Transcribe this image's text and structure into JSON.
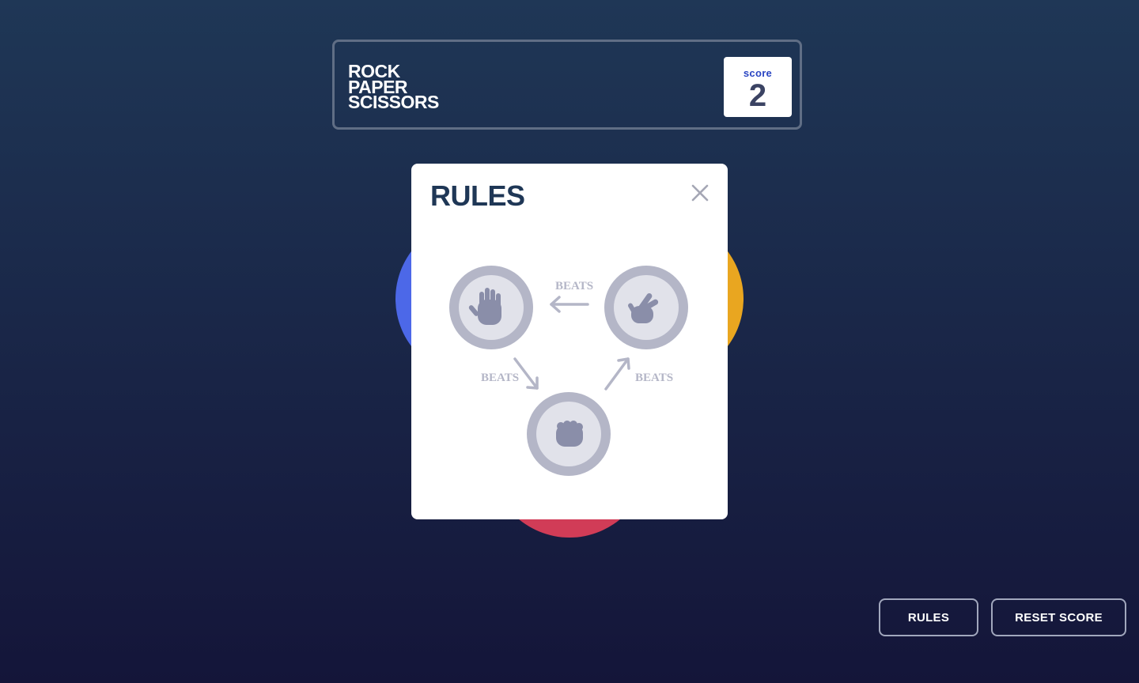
{
  "header": {
    "logo_lines": [
      "ROCK",
      "PAPER",
      "SCISSORS"
    ],
    "score_label": "score",
    "score_value": "2"
  },
  "game": {
    "tokens": [
      {
        "name": "paper",
        "color": "#4c68e8"
      },
      {
        "name": "scissors",
        "color": "#e9a620"
      },
      {
        "name": "rock",
        "color": "#d13c57"
      }
    ]
  },
  "rules_modal": {
    "title": "RULES",
    "close_icon": "close-icon",
    "beats_top": "BEATS",
    "beats_left": "BEATS",
    "beats_right": "BEATS",
    "items": [
      {
        "name": "paper",
        "icon": "paper-hand-icon"
      },
      {
        "name": "scissors",
        "icon": "scissors-hand-icon"
      },
      {
        "name": "rock",
        "icon": "rock-fist-icon"
      }
    ]
  },
  "footer": {
    "rules_button": "RULES",
    "reset_button": "RESET SCORE"
  },
  "colors": {
    "bg_top": "#1f3756",
    "bg_bottom": "#141539",
    "header_border": "#606e85",
    "score_label": "#2a45c2",
    "score_value": "#3b4363",
    "modal_title": "#1f3756",
    "diagram_gray": "#b4b6c7"
  }
}
